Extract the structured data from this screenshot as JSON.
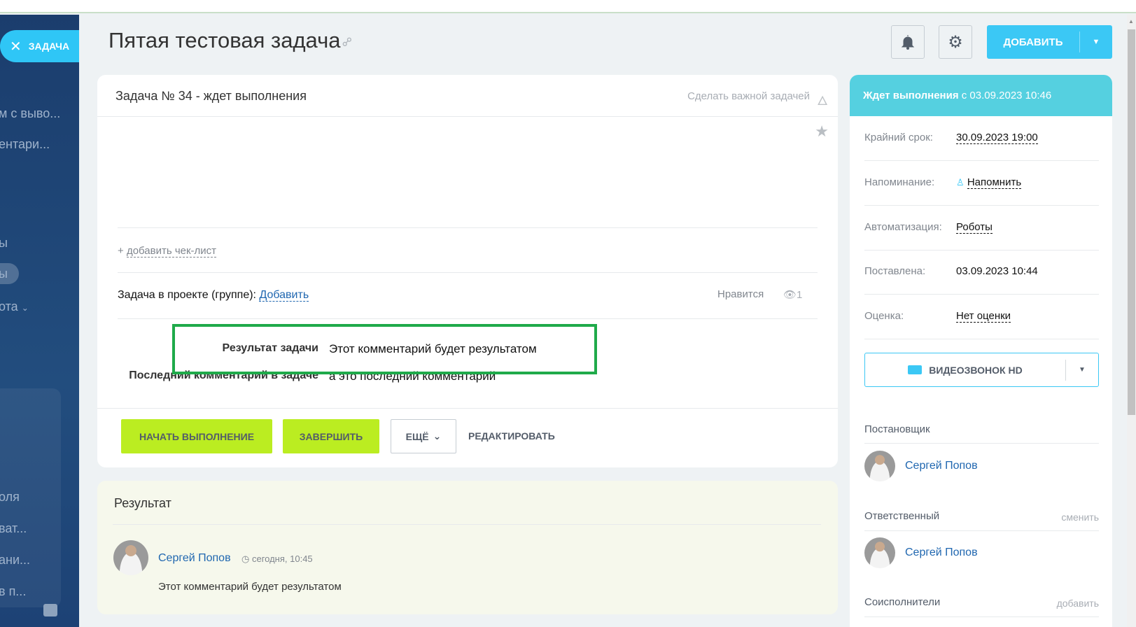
{
  "sidebar": {
    "task_pill": "ЗАДАЧА",
    "items": [
      "м с выво...",
      "ентари...",
      "ы",
      "ы",
      "ота",
      "оля",
      "ват...",
      "ани...",
      "в п..."
    ]
  },
  "header": {
    "title": "Пятая тестовая задача",
    "add_label": "ДОБАВИТЬ"
  },
  "task": {
    "heading": "Задача № 34 - ждет выполнения",
    "make_important": "Сделать важной задачей",
    "add_checklist_plus": "+",
    "add_checklist": "добавить чек-лист",
    "project_label": "Задача в проекте (группе):",
    "project_add": "Добавить",
    "like": "Нравится",
    "views": "1",
    "result_label": "Результат задачи",
    "result_value": "Этот комментарий будет результатом",
    "last_comment_label": "Последний комментарий в задаче",
    "last_comment_value": "а это последний комментарий",
    "buttons": {
      "start": "НАЧАТЬ ВЫПОЛНЕНИЕ",
      "finish": "ЗАВЕРШИТЬ",
      "more": "ЕЩЁ",
      "edit": "РЕДАКТИРОВАТЬ"
    }
  },
  "result": {
    "title": "Результат",
    "author": "Сергей Попов",
    "time": "сегодня, 10:45",
    "text": "Этот комментарий будет результатом"
  },
  "side": {
    "status_bold": "Ждет выполнения",
    "status_rest": " с 03.09.2023 10:46",
    "rows": [
      {
        "label": "Крайний срок:",
        "value": "30.09.2023 19:00"
      },
      {
        "label": "Напоминание:",
        "value": "Напомнить"
      },
      {
        "label": "Автоматизация:",
        "value": "Роботы"
      },
      {
        "label": "Поставлена:",
        "value": "03.09.2023 10:44"
      },
      {
        "label": "Оценка:",
        "value": "Нет оценки"
      }
    ],
    "video_call": "ВИДЕОЗВОНОК HD",
    "creator_title": "Постановщик",
    "creator_name": "Сергей Попов",
    "responsible_title": "Ответственный",
    "responsible_change": "сменить",
    "responsible_name": "Сергей Попов",
    "coexec_title": "Соисполнители",
    "coexec_add": "добавить"
  },
  "colors": {
    "accent": "#2fc6f6",
    "status_header": "#55d0e0",
    "green_btn": "#bbed21",
    "highlight": "#1faa4a",
    "link": "#2067b0"
  }
}
